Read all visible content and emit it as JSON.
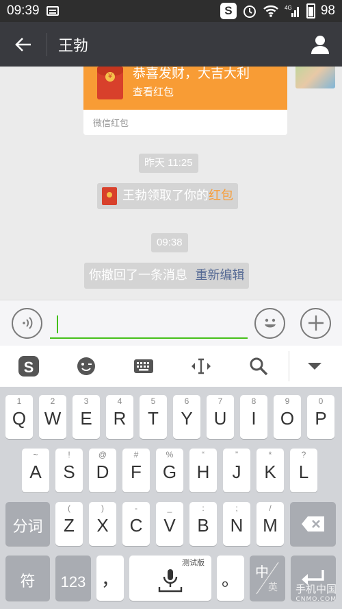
{
  "status_bar": {
    "time": "09:39",
    "battery": "98",
    "network": "4G"
  },
  "title_bar": {
    "title": "王勃"
  },
  "chat": {
    "red_packet": {
      "title": "恭喜发财，大吉大利",
      "action": "查看红包",
      "footer": "微信红包"
    },
    "timestamp_1": "昨天 11:25",
    "received_notice": {
      "prefix": "王勃领取了你的",
      "link": "红包"
    },
    "timestamp_2": "09:38",
    "recall_notice": {
      "text": "你撤回了一条消息",
      "action": "重新编辑"
    }
  },
  "input_bar": {
    "value": ""
  },
  "ime_toolbar": {
    "items": [
      "sogou-logo",
      "emoji",
      "keyboard",
      "cursor-move",
      "search",
      "collapse"
    ]
  },
  "keyboard": {
    "row1": [
      {
        "main": "Q",
        "sub": "1"
      },
      {
        "main": "W",
        "sub": "2"
      },
      {
        "main": "E",
        "sub": "3"
      },
      {
        "main": "R",
        "sub": "4"
      },
      {
        "main": "T",
        "sub": "5"
      },
      {
        "main": "Y",
        "sub": "6"
      },
      {
        "main": "U",
        "sub": "7"
      },
      {
        "main": "I",
        "sub": "8"
      },
      {
        "main": "O",
        "sub": "9"
      },
      {
        "main": "P",
        "sub": "0"
      }
    ],
    "row2": [
      {
        "main": "A",
        "sub": "~"
      },
      {
        "main": "S",
        "sub": "!"
      },
      {
        "main": "D",
        "sub": "@"
      },
      {
        "main": "F",
        "sub": "#"
      },
      {
        "main": "G",
        "sub": "%"
      },
      {
        "main": "H",
        "sub": "“"
      },
      {
        "main": "J",
        "sub": "”"
      },
      {
        "main": "K",
        "sub": "*"
      },
      {
        "main": "L",
        "sub": "?"
      }
    ],
    "row3": [
      {
        "main": "Z",
        "sub": "("
      },
      {
        "main": "X",
        "sub": ")"
      },
      {
        "main": "C",
        "sub": "-"
      },
      {
        "main": "V",
        "sub": "_"
      },
      {
        "main": "B",
        "sub": ":"
      },
      {
        "main": "N",
        "sub": ";"
      },
      {
        "main": "M",
        "sub": "/"
      }
    ],
    "fenci": "分词",
    "fu": "符",
    "num": "123",
    "comma": "，",
    "space_label": "测试版",
    "period": "。",
    "zh": "中",
    "zh_alt": "英"
  },
  "watermark": {
    "line1": "手机中国",
    "line2": "CNMO.COM"
  }
}
